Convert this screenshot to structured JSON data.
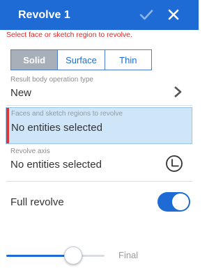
{
  "header": {
    "title": "Revolve 1",
    "accept_icon": "checkmark-icon",
    "close_icon": "close-icon",
    "color": "#1f6bd6"
  },
  "error_message": "Select face or sketch region to revolve.",
  "mode_tabs": [
    {
      "label": "Solid",
      "active": true
    },
    {
      "label": "Surface",
      "active": false
    },
    {
      "label": "Thin",
      "active": false
    }
  ],
  "result_body": {
    "label": "Result body operation type",
    "value": "New",
    "icon": "chevron-right-icon"
  },
  "faces": {
    "label": "Faces and sketch regions to revolve",
    "value": "No entities selected",
    "highlight_color": "#cfe6f8",
    "error_bar_color": "#d83a3a"
  },
  "revolve_axis": {
    "label": "Revolve axis",
    "value": "No entities selected",
    "icon": "axis-selector-icon"
  },
  "full_revolve": {
    "label": "Full revolve",
    "on": true
  },
  "history_slider": {
    "label": "Final",
    "position": 0.68
  }
}
